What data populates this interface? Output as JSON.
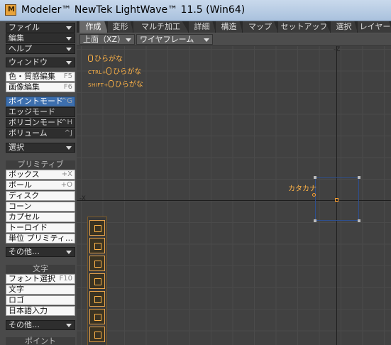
{
  "window": {
    "title": "Modeler™ NewTek LightWave™ 11.5 (Win64)"
  },
  "left_panel": {
    "menus": [
      {
        "label": "ファイル"
      },
      {
        "label": "編集"
      },
      {
        "label": "ヘルプ"
      },
      {
        "label": "ウィンドウ"
      }
    ],
    "tools": [
      {
        "label": "色・質感編集",
        "shortcut": "F5"
      },
      {
        "label": "画像編集",
        "shortcut": "F6"
      }
    ],
    "modes": [
      {
        "label": "ポイントモード",
        "shortcut": "^G",
        "selected": true
      },
      {
        "label": "エッジモード",
        "shortcut": ""
      },
      {
        "label": "ポリゴンモード",
        "shortcut": "^H"
      },
      {
        "label": "ボリューム",
        "shortcut": "^J"
      }
    ],
    "select_dropdown": "選択",
    "primitive_header": "プリミティブ",
    "primitives": [
      {
        "label": "ボックス",
        "shortcut": "+X"
      },
      {
        "label": "ボール",
        "shortcut": "+O"
      },
      {
        "label": "ディスク",
        "shortcut": ""
      },
      {
        "label": "コーン",
        "shortcut": ""
      },
      {
        "label": "カプセル",
        "shortcut": ""
      },
      {
        "label": "トーロイド",
        "shortcut": ""
      },
      {
        "label": "単位 プリミティ…",
        "shortcut": ""
      }
    ],
    "primitives_more": "その他…",
    "text_header": "文字",
    "text_tools": [
      {
        "label": "フォント選択",
        "shortcut": "F10"
      },
      {
        "label": "文字",
        "shortcut": ""
      },
      {
        "label": "ロゴ",
        "shortcut": ""
      },
      {
        "label": "日本語入力",
        "shortcut": ""
      }
    ],
    "text_more": "その他…",
    "point_header": "ポイント"
  },
  "tabs": [
    {
      "label": "作成",
      "active": true
    },
    {
      "label": "変形"
    },
    {
      "label": "マルチ加工"
    },
    {
      "label": "詳細"
    },
    {
      "label": "構造"
    },
    {
      "label": "マップ"
    },
    {
      "label": "セットアップ"
    },
    {
      "label": "選択"
    },
    {
      "label": "レイヤー"
    }
  ],
  "viewport": {
    "view_selector": "上面（XZ）",
    "render_mode": "ワイヤフレーム",
    "hints": [
      {
        "modifier": "",
        "text": "ひらがな"
      },
      {
        "modifier": "CTRL+",
        "text": "ひらがな"
      },
      {
        "modifier": "SHIFT+",
        "text": "ひらがな"
      }
    ],
    "axis_label_z": "-Z",
    "axis_label_x": "-X",
    "object_label": "カタカナ"
  },
  "colors": {
    "accent": "#ffb347",
    "selection": "#3d6fae"
  }
}
